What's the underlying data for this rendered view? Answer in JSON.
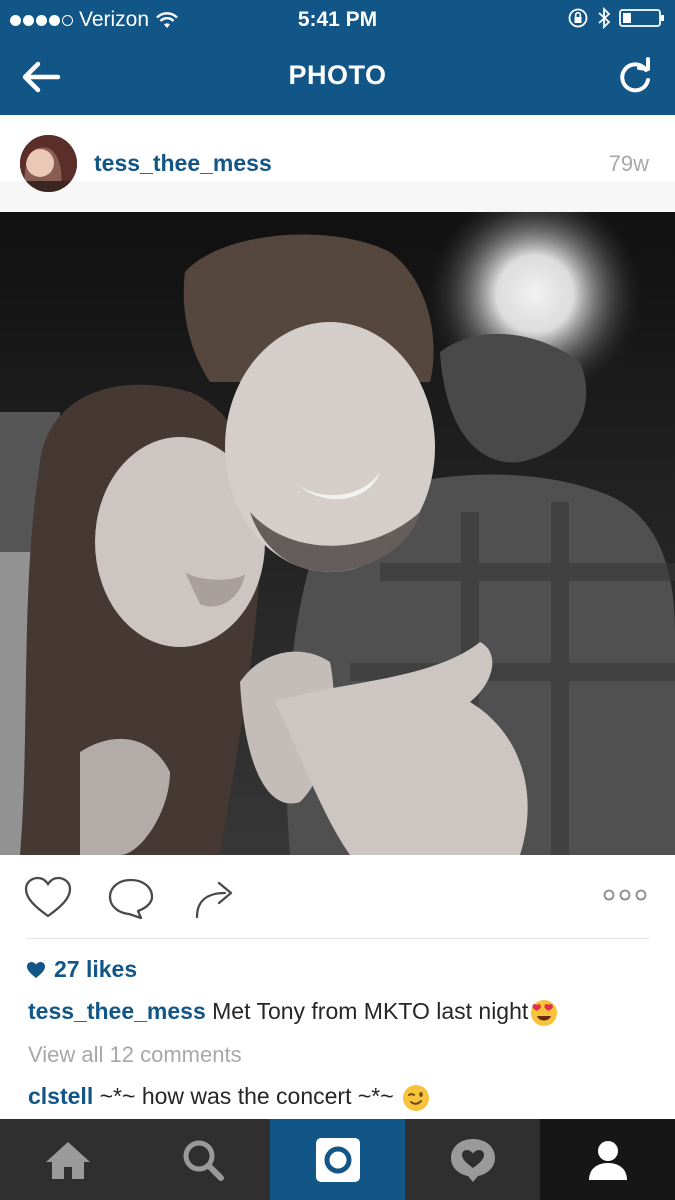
{
  "status_bar": {
    "carrier": "Verizon",
    "time": "5:41 PM",
    "signal_bars": 4
  },
  "nav": {
    "title": "PHOTO",
    "back_icon": "arrow-left-icon",
    "refresh_icon": "refresh-icon"
  },
  "post": {
    "username": "tess_thee_mess",
    "time_ago": "79w",
    "likes": "27 likes",
    "caption_user": "tess_thee_mess",
    "caption_text": "Met Tony from MKTO last night",
    "view_comments": "View all 12 comments",
    "comments": [
      {
        "user": "clstell",
        "text": "~*~ how was the concert ~*~"
      }
    ]
  },
  "colors": {
    "brand": "#125688",
    "tab_bg": "#2f2f2f",
    "muted": "#a8a8a8"
  },
  "tabs": [
    {
      "icon": "home-icon"
    },
    {
      "icon": "search-icon"
    },
    {
      "icon": "camera-icon",
      "active": true
    },
    {
      "icon": "activity-icon"
    },
    {
      "icon": "profile-icon"
    }
  ]
}
